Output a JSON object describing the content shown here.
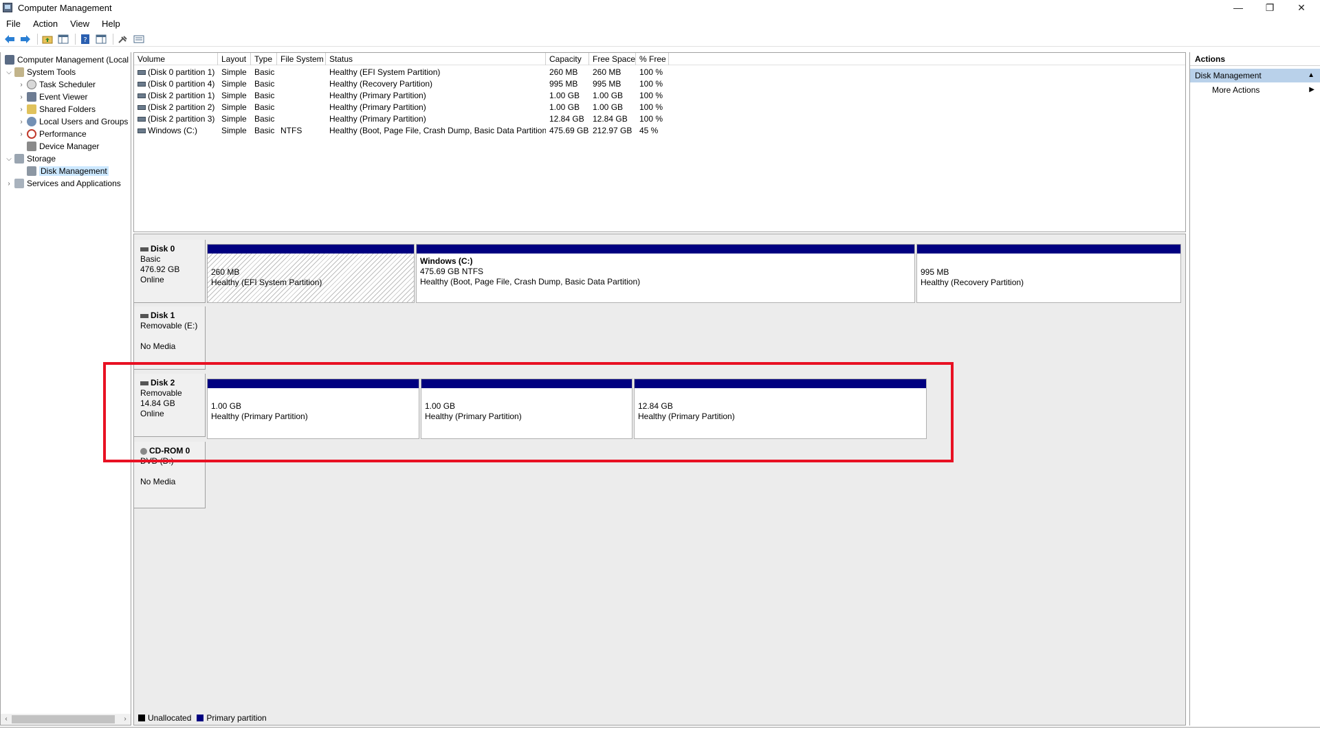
{
  "window": {
    "title": "Computer Management",
    "minimize": "—",
    "restore": "❐",
    "close": "✕"
  },
  "menu": [
    "File",
    "Action",
    "View",
    "Help"
  ],
  "tree": {
    "root": "Computer Management (Local",
    "system_tools": "System Tools",
    "task_scheduler": "Task Scheduler",
    "event_viewer": "Event Viewer",
    "shared_folders": "Shared Folders",
    "local_users": "Local Users and Groups",
    "performance": "Performance",
    "device_manager": "Device Manager",
    "storage": "Storage",
    "disk_management": "Disk Management",
    "services": "Services and Applications"
  },
  "volume_list": {
    "columns": [
      "Volume",
      "Layout",
      "Type",
      "File System",
      "Status",
      "Capacity",
      "Free Space",
      "% Free"
    ],
    "rows": [
      [
        "(Disk 0 partition 1)",
        "Simple",
        "Basic",
        "",
        "Healthy (EFI System Partition)",
        "260 MB",
        "260 MB",
        "100 %"
      ],
      [
        "(Disk 0 partition 4)",
        "Simple",
        "Basic",
        "",
        "Healthy (Recovery Partition)",
        "995 MB",
        "995 MB",
        "100 %"
      ],
      [
        "(Disk 2 partition 1)",
        "Simple",
        "Basic",
        "",
        "Healthy (Primary Partition)",
        "1.00 GB",
        "1.00 GB",
        "100 %"
      ],
      [
        "(Disk 2 partition 2)",
        "Simple",
        "Basic",
        "",
        "Healthy (Primary Partition)",
        "1.00 GB",
        "1.00 GB",
        "100 %"
      ],
      [
        "(Disk 2 partition 3)",
        "Simple",
        "Basic",
        "",
        "Healthy (Primary Partition)",
        "12.84 GB",
        "12.84 GB",
        "100 %"
      ],
      [
        "Windows (C:)",
        "Simple",
        "Basic",
        "NTFS",
        "Healthy (Boot, Page File, Crash Dump, Basic Data Partition)",
        "475.69 GB",
        "212.97 GB",
        "45 %"
      ]
    ]
  },
  "disks": {
    "disk0": {
      "name": "Disk 0",
      "type": "Basic",
      "size": "476.92 GB",
      "status": "Online",
      "p1_size": "260 MB",
      "p1_status": "Healthy (EFI System Partition)",
      "p2_name": "Windows  (C:)",
      "p2_size": "475.69 GB NTFS",
      "p2_status": "Healthy (Boot, Page File, Crash Dump, Basic Data Partition)",
      "p3_size": "995 MB",
      "p3_status": "Healthy (Recovery Partition)"
    },
    "disk1": {
      "name": "Disk 1",
      "type": "Removable (E:)",
      "status": "No Media"
    },
    "disk2": {
      "name": "Disk 2",
      "type": "Removable",
      "size": "14.84 GB",
      "status": "Online",
      "p1_size": "1.00 GB",
      "p1_status": "Healthy (Primary Partition)",
      "p2_size": "1.00 GB",
      "p2_status": "Healthy (Primary Partition)",
      "p3_size": "12.84 GB",
      "p3_status": "Healthy (Primary Partition)"
    },
    "cdrom0": {
      "name": "CD-ROM 0",
      "type": "DVD (D:)",
      "status": "No Media"
    }
  },
  "legend": {
    "unallocated": "Unallocated",
    "primary": "Primary partition",
    "unallocated_color": "#000000",
    "primary_color": "#000080"
  },
  "actions": {
    "title": "Actions",
    "section": "Disk Management",
    "more": "More Actions"
  }
}
